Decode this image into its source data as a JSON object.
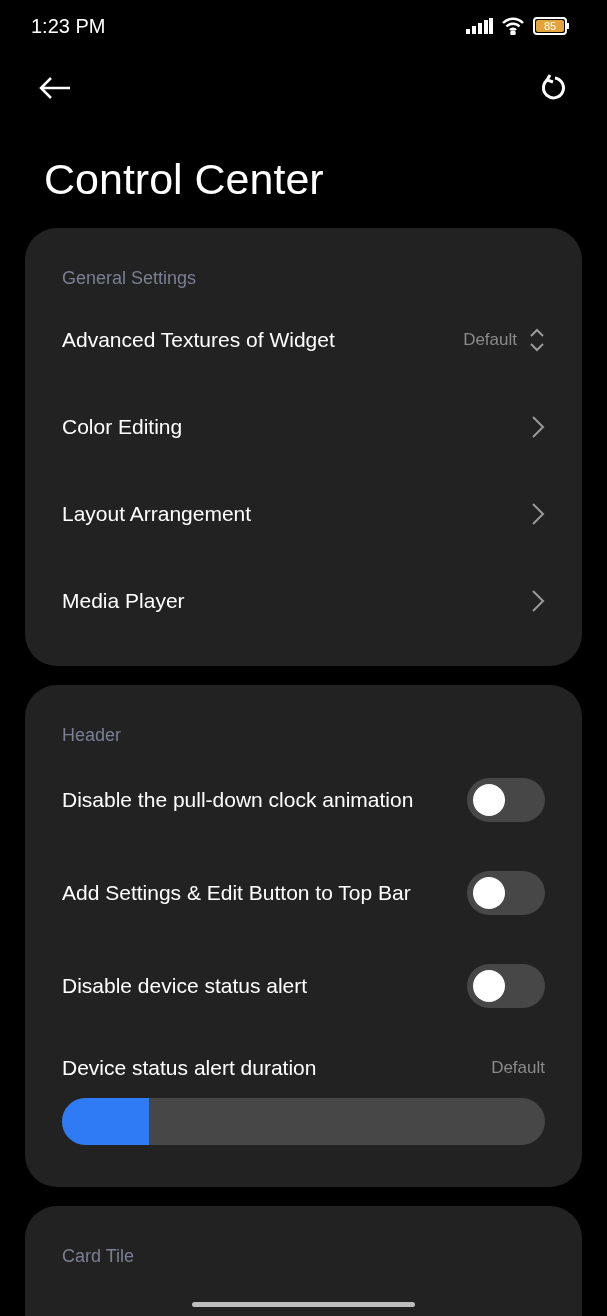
{
  "status_bar": {
    "time": "1:23 PM",
    "battery": "85"
  },
  "title": "Control Center",
  "sections": [
    {
      "header": "General Settings",
      "rows": [
        {
          "kind": "select",
          "label": "Advanced Textures of Widget",
          "value": "Default"
        },
        {
          "kind": "link",
          "label": "Color Editing"
        },
        {
          "kind": "link",
          "label": "Layout Arrangement"
        },
        {
          "kind": "link",
          "label": "Media Player"
        }
      ]
    },
    {
      "header": "Header",
      "rows": [
        {
          "kind": "toggle",
          "label": "Disable the pull-down clock animation",
          "on": false
        },
        {
          "kind": "toggle",
          "label": "Add Settings & Edit Button to Top Bar",
          "on": false
        },
        {
          "kind": "toggle",
          "label": "Disable device status alert",
          "on": false
        },
        {
          "kind": "slider",
          "label": "Device status alert duration",
          "value": "Default",
          "level": 0.18
        }
      ]
    },
    {
      "header": "Card Tile"
    }
  ]
}
